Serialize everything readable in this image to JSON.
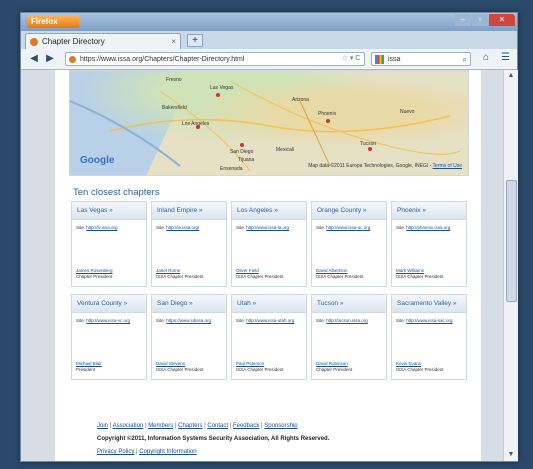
{
  "browser": {
    "app_button": "Firefox",
    "window_controls": {
      "minimize": "–",
      "maximize": "▫",
      "close": "✕"
    },
    "tab": {
      "title": "Chapter Directory",
      "close": "×"
    },
    "new_tab": "+",
    "nav": {
      "back": "◀",
      "forward": "▶"
    },
    "url": "https://www.issa.org/Chapters/Chapter-Directory.html",
    "url_tools": "☆ ▾ C",
    "search_text": "issa",
    "search_icon": "⌕",
    "home_icon": "⌂",
    "bookmarks_icon": "☰"
  },
  "map": {
    "google_logo": "Google",
    "credit": "Map data ©2011 Europa Technologies, Google, INEGI - ",
    "terms": "Terms of Use",
    "labels": [
      "Las Vegas",
      "Fresno",
      "Bakersfield",
      "Los Angeles",
      "San Diego",
      "Phoenix",
      "Tucson",
      "Mexicali",
      "Tijuana",
      "Ensenada",
      "Arizona",
      "Nuevo"
    ]
  },
  "section_title": "Ten closest chapters",
  "chapters": [
    {
      "name": "Las Vegas",
      "site_label": "Site:",
      "site": "http://lv.issa.org",
      "person": "James Rosenberg",
      "role": "Chapter President"
    },
    {
      "name": "Inland Empire",
      "site_label": "Site:",
      "site": "http://ie.issa.org/",
      "person": "Janet Rome",
      "role": "ISSA Chapter President"
    },
    {
      "name": "Los Angeles",
      "site_label": "Site:",
      "site": "http://www.issa-la.org",
      "person": "Oliver Field",
      "role": "ISSA Chapter President"
    },
    {
      "name": "Orange County",
      "site_label": "Site:",
      "site": "http://www.issa-oc.org",
      "person": "David Albertson",
      "role": "ISSA Chapter President"
    },
    {
      "name": "Phoenix",
      "site_label": "Site:",
      "site": "http://phoenix.issa.org",
      "person": "Mark Williams",
      "role": "ISSA Chapter President"
    },
    {
      "name": "Ventura County",
      "site_label": "Site:",
      "site": "http://www.issa-vc.org",
      "person": "Michael Blair",
      "role": "President"
    },
    {
      "name": "San Diego",
      "site_label": "Site:",
      "site": "https://www.sdissa.org",
      "person": "David Stevens",
      "role": "ISSA Chapter President"
    },
    {
      "name": "Utah",
      "site_label": "Site:",
      "site": "http://www.issa-utah.org",
      "person": "Paul Peterson",
      "role": "ISSA Chapter President"
    },
    {
      "name": "Tucson",
      "site_label": "Site:",
      "site": "http://tucson.issa.org",
      "person": "David Robinson",
      "role": "Chapter President"
    },
    {
      "name": "Sacramento Valley",
      "site_label": "Site:",
      "site": "http://www.issa-sac.org",
      "person": "Kevin Evans",
      "role": "ISSA Chapter President"
    }
  ],
  "card_chevron": "»",
  "footer": {
    "links": [
      "Join",
      "Association",
      "Members",
      "Chapters",
      "Contact",
      "Feedback",
      "Sponsorship"
    ],
    "separator": "|",
    "copyright": "Copyright ©2011, Information Systems Security Association, All Rights Reserved.",
    "links2": [
      "Privacy Policy",
      "Copyright Information"
    ]
  },
  "scrollbar": {
    "up": "▲",
    "down": "▼"
  }
}
